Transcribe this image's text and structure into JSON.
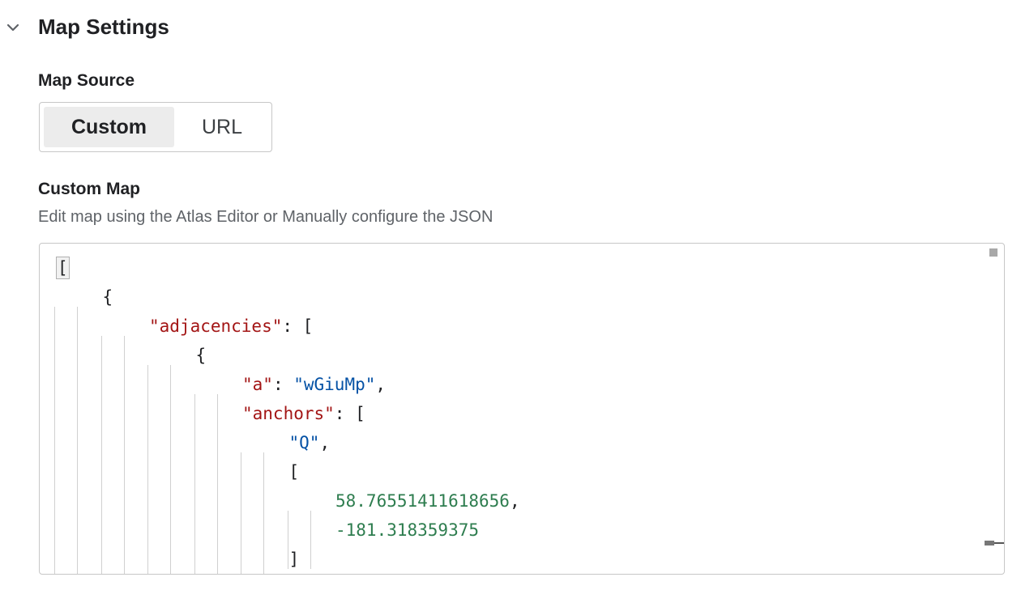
{
  "section": {
    "title": "Map Settings",
    "expand_icon": "chevron-down-icon"
  },
  "map_source": {
    "label": "Map Source",
    "options": [
      "Custom",
      "URL"
    ],
    "selected": "Custom"
  },
  "custom_map": {
    "label": "Custom Map",
    "help_text": "Edit map using the Atlas Editor or Manually configure the JSON"
  },
  "editor": {
    "lines": [
      {
        "indent": 0,
        "tokens": [
          {
            "t": "punc",
            "v": "["
          }
        ],
        "cursor": true
      },
      {
        "indent": 1,
        "tokens": [
          {
            "t": "punc",
            "v": "{"
          }
        ]
      },
      {
        "indent": 2,
        "tokens": [
          {
            "t": "key",
            "v": "\"adjacencies\""
          },
          {
            "t": "punc",
            "v": ": ["
          }
        ]
      },
      {
        "indent": 3,
        "tokens": [
          {
            "t": "punc",
            "v": "{"
          }
        ]
      },
      {
        "indent": 4,
        "tokens": [
          {
            "t": "key",
            "v": "\"a\""
          },
          {
            "t": "punc",
            "v": ": "
          },
          {
            "t": "str",
            "v": "\"wGiuMp\""
          },
          {
            "t": "punc",
            "v": ","
          }
        ]
      },
      {
        "indent": 4,
        "tokens": [
          {
            "t": "key",
            "v": "\"anchors\""
          },
          {
            "t": "punc",
            "v": ": ["
          }
        ]
      },
      {
        "indent": 5,
        "tokens": [
          {
            "t": "str",
            "v": "\"Q\""
          },
          {
            "t": "punc",
            "v": ","
          }
        ]
      },
      {
        "indent": 5,
        "tokens": [
          {
            "t": "punc",
            "v": "["
          }
        ]
      },
      {
        "indent": 6,
        "tokens": [
          {
            "t": "num",
            "v": "58.76551411618656"
          },
          {
            "t": "punc",
            "v": ","
          }
        ]
      },
      {
        "indent": 6,
        "tokens": [
          {
            "t": "num",
            "v": "-181.318359375"
          }
        ]
      },
      {
        "indent": 5,
        "tokens": [
          {
            "t": "punc",
            "v": "]"
          }
        ]
      }
    ],
    "colors": {
      "key": "#a31515",
      "string": "#0451a5",
      "number": "#2e7d4f"
    }
  }
}
